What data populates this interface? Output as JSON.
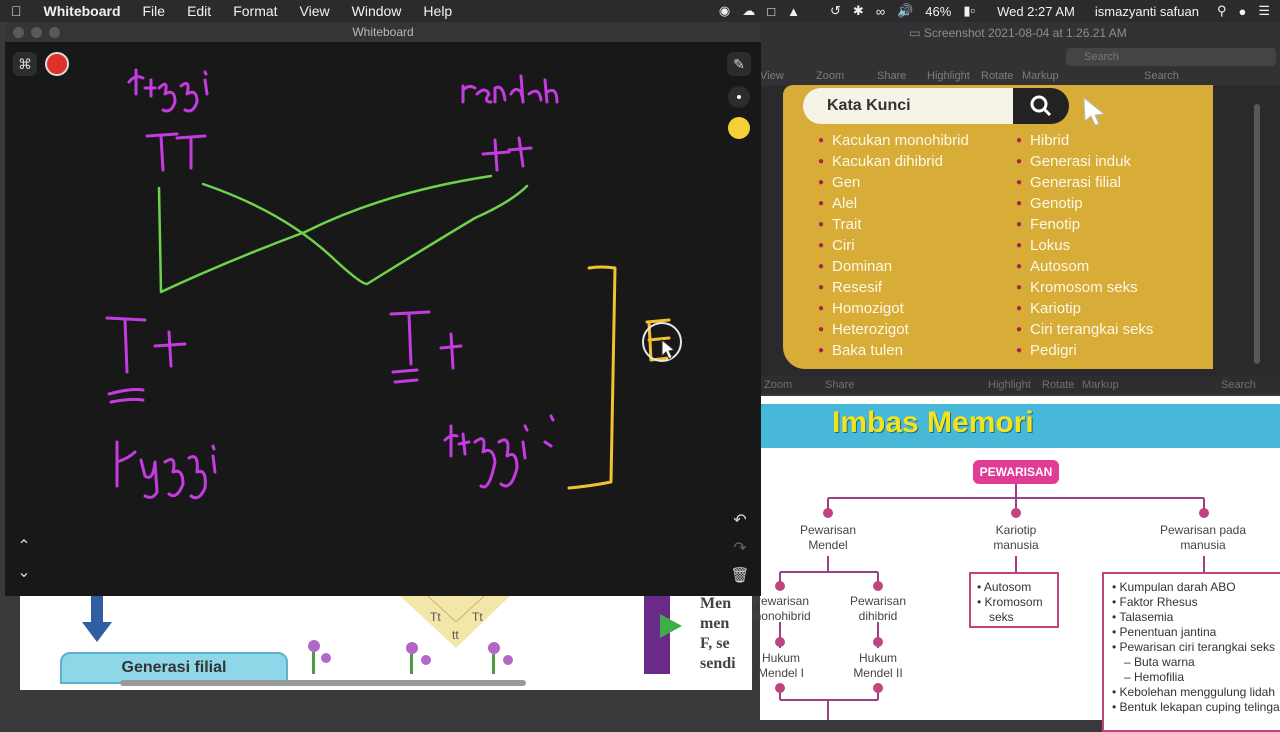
{
  "menubar": {
    "app_name": "Whiteboard",
    "menus": [
      "File",
      "Edit",
      "Format",
      "View",
      "Window",
      "Help"
    ],
    "battery": "46%",
    "datetime": "Wed 2:27 AM",
    "user": "ismazyanti safuan"
  },
  "whiteboard": {
    "title": "Whiteboard",
    "record_color": "#e0302e",
    "pen_color": "#f5d03a",
    "ink_purple": "#c43be0",
    "ink_green": "#6fd24b",
    "ink_yellow": "#f0c232"
  },
  "preview": {
    "title": "Screenshot 2021-08-04 at 1.26.21 AM",
    "toolbar": [
      "View",
      "Zoom",
      "Share",
      "Highlight",
      "Rotate",
      "Markup"
    ],
    "search_placeholder": "Search",
    "search_label": "Search",
    "lower_toolbar": [
      "Zoom",
      "Share",
      "Highlight",
      "Rotate",
      "Markup",
      "Search"
    ]
  },
  "kata_kunci": {
    "title": "Kata Kunci",
    "col1": [
      "Kacukan monohibrid",
      "Kacukan dihibrid",
      "Gen",
      "Alel",
      "Trait",
      "Ciri",
      "Dominan",
      "Resesif",
      "Homozigot",
      "Heterozigot",
      "Baka tulen"
    ],
    "col2": [
      "Hibrid",
      "Generasi induk",
      "Generasi filial",
      "Genotip",
      "Fenotip",
      "Lokus",
      "Autosom",
      "Kromosom seks",
      "Kariotip",
      "Ciri terangkai seks",
      "Pedigri"
    ]
  },
  "imbas": {
    "title": "Imbas Memori",
    "root": "PEWARISAN",
    "branch1": [
      "Pewarisan",
      "Mendel"
    ],
    "branch2": [
      "Kariotip",
      "manusia"
    ],
    "branch3": [
      "Pewarisan pada",
      "manusia"
    ],
    "sub1a": [
      "Pewarisan",
      "monohibrid"
    ],
    "sub1b": [
      "Pewarisan",
      "dihibrid"
    ],
    "law1": [
      "Hukum",
      "Mendel I"
    ],
    "law2": [
      "Hukum",
      "Mendel II"
    ],
    "box2": [
      "Autosom",
      "Kromosom",
      "seks"
    ],
    "box3": [
      "Kumpulan darah ABO",
      "Faktor Rhesus",
      "Talasemia",
      "Penentuan jantina",
      "Pewarisan ciri terangkai seks",
      "– Buta warna",
      "– Hemofilia",
      "Kebolehan menggulung lidah",
      "Bentuk lekapan cuping telinga"
    ]
  },
  "doc_bl": {
    "box_label": "Generasi filial",
    "tt1": "Tt",
    "tt2": "Tt",
    "tt3": "tt",
    "side_text": [
      "Men",
      "men",
      "F, se",
      "sendi"
    ]
  }
}
